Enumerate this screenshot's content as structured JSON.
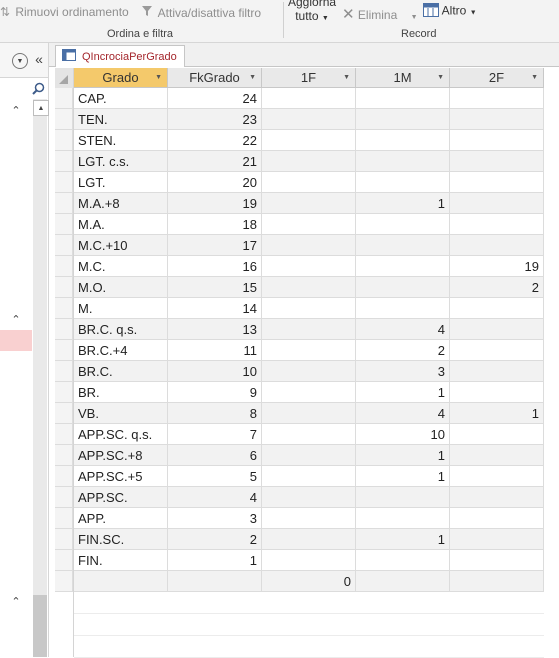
{
  "ribbon": {
    "remove_sort_label": "Rimuovi ordinamento",
    "toggle_filter_label": "Attiva/disattiva filtro",
    "sort_filter_group": "Ordina e filtra",
    "refresh_label_1": "Aggiorna",
    "refresh_label_2": "tutto",
    "delete_label": "Elimina",
    "more_label": "Altro",
    "records_group": "Record"
  },
  "document": {
    "tab_title": "QIncrociaPerGrado"
  },
  "table": {
    "columns": [
      "Grado",
      "FkGrado",
      "1F",
      "1M",
      "2F"
    ],
    "rows": [
      [
        "CAP.",
        "24",
        "",
        "",
        ""
      ],
      [
        "TEN.",
        "23",
        "",
        "",
        ""
      ],
      [
        "STEN.",
        "22",
        "",
        "",
        ""
      ],
      [
        "LGT. c.s.",
        "21",
        "",
        "",
        ""
      ],
      [
        "LGT.",
        "20",
        "",
        "",
        ""
      ],
      [
        "M.A.+8",
        "19",
        "",
        "1",
        ""
      ],
      [
        "M.A.",
        "18",
        "",
        "",
        ""
      ],
      [
        "M.C.+10",
        "17",
        "",
        "",
        ""
      ],
      [
        "M.C.",
        "16",
        "",
        "",
        "19"
      ],
      [
        "M.O.",
        "15",
        "",
        "",
        "2"
      ],
      [
        "M.",
        "14",
        "",
        "",
        ""
      ],
      [
        "BR.C. q.s.",
        "13",
        "",
        "4",
        ""
      ],
      [
        "BR.C.+4",
        "11",
        "",
        "2",
        ""
      ],
      [
        "BR.C.",
        "10",
        "",
        "3",
        ""
      ],
      [
        "BR.",
        "9",
        "",
        "1",
        ""
      ],
      [
        "VB.",
        "8",
        "",
        "4",
        "1"
      ],
      [
        "APP.SC. q.s.",
        "7",
        "",
        "10",
        ""
      ],
      [
        "APP.SC.+8",
        "6",
        "",
        "1",
        ""
      ],
      [
        "APP.SC.+5",
        "5",
        "",
        "1",
        ""
      ],
      [
        "APP.SC.",
        "4",
        "",
        "",
        ""
      ],
      [
        "APP.",
        "3",
        "",
        "",
        ""
      ],
      [
        "FIN.SC.",
        "2",
        "",
        "1",
        ""
      ],
      [
        "FIN.",
        "1",
        "",
        "",
        ""
      ]
    ],
    "totals": [
      "",
      "",
      "0",
      "",
      ""
    ]
  },
  "icons": {
    "sort_remove": "remove-sort-icon",
    "filter": "filter-icon",
    "delete": "delete-icon",
    "more": "more-icon"
  },
  "colors": {
    "selected_header": "#f4c96b",
    "tab_text": "#a4262c",
    "nav_highlight": "#f9d0d0"
  }
}
